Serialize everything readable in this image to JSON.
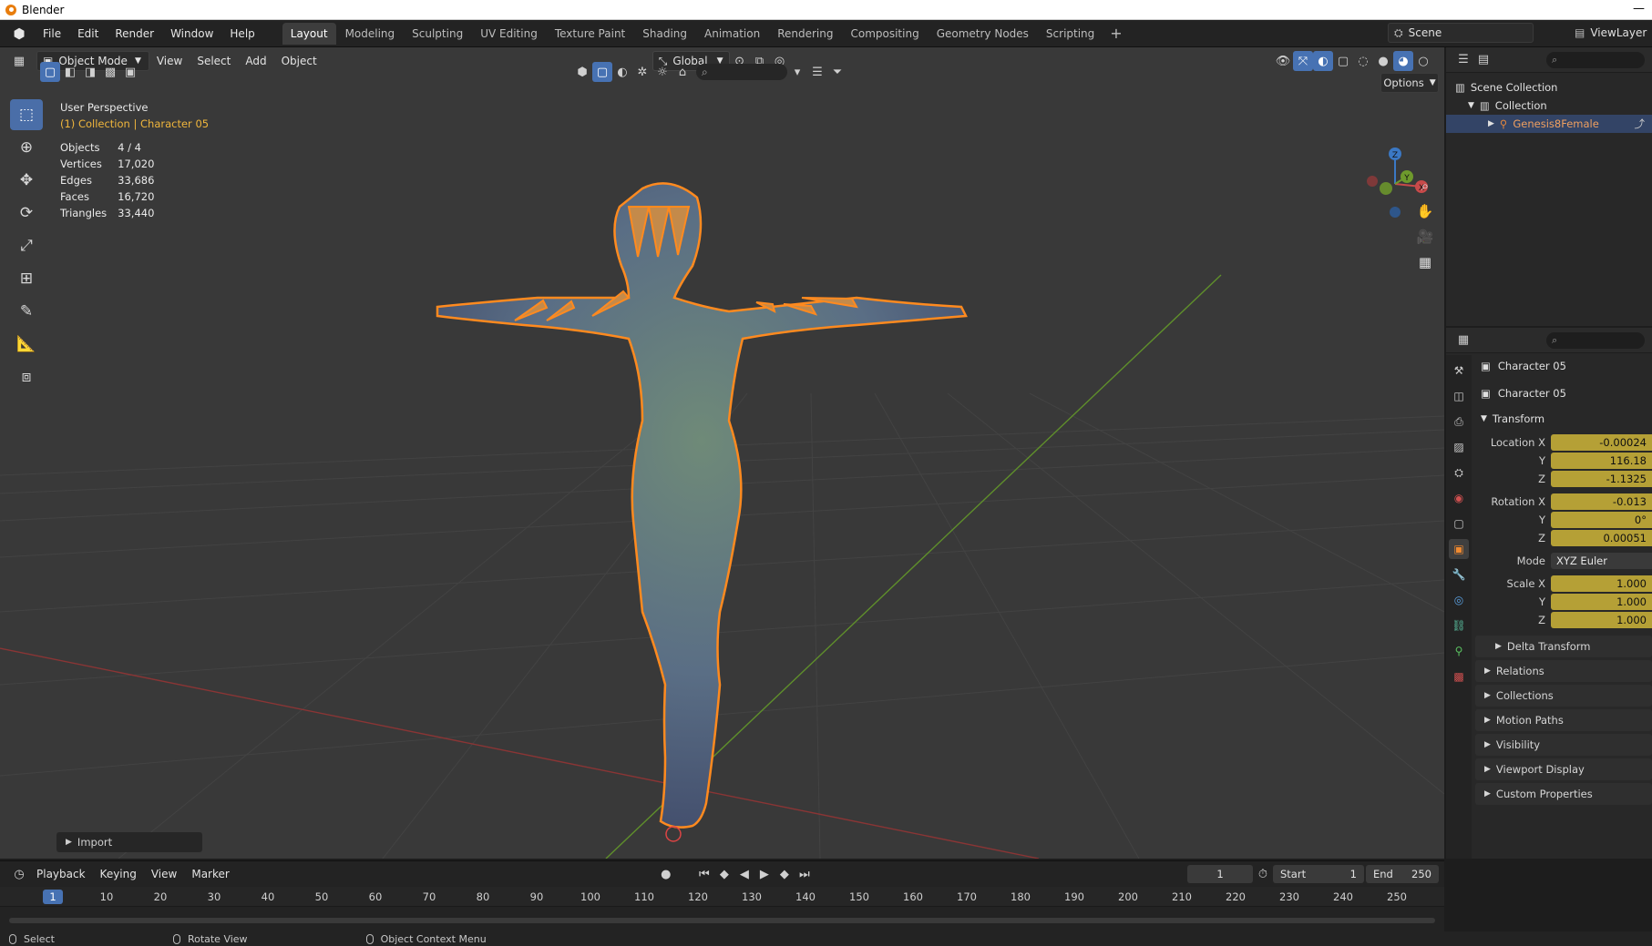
{
  "window": {
    "title": "Blender",
    "minimize_glyph": "—"
  },
  "menu": [
    "File",
    "Edit",
    "Render",
    "Window",
    "Help"
  ],
  "workspaces": [
    "Layout",
    "Modeling",
    "Sculpting",
    "UV Editing",
    "Texture Paint",
    "Shading",
    "Animation",
    "Rendering",
    "Compositing",
    "Geometry Nodes",
    "Scripting"
  ],
  "active_workspace": "Layout",
  "add_workspace": "+",
  "scene": "Scene",
  "view_layer": "ViewLayer",
  "viewport": {
    "mode": "Object Mode",
    "menus": [
      "View",
      "Select",
      "Add",
      "Object"
    ],
    "orientation": "Global",
    "options": "Options",
    "overlay_title": "User Perspective",
    "overlay_sub": "(1) Collection | Character 05",
    "stats": [
      {
        "label": "Objects",
        "value": "4 / 4"
      },
      {
        "label": "Vertices",
        "value": "17,020"
      },
      {
        "label": "Edges",
        "value": "33,686"
      },
      {
        "label": "Faces",
        "value": "16,720"
      },
      {
        "label": "Triangles",
        "value": "33,440"
      }
    ],
    "gizmo": {
      "z": "Z",
      "y": "Y",
      "x": "X"
    },
    "import_panel": "Import",
    "accent_colors": {
      "outline": "#ff8a1f",
      "x_axis": "#b33b3b",
      "y_axis": "#6e9a2c",
      "active_blue": "#4772b3"
    }
  },
  "outliner": {
    "root": "Scene Collection",
    "collection": "Collection",
    "object": "Genesis8Female"
  },
  "properties": {
    "object_name": "Character 05",
    "data_name": "Character 05",
    "transform_label": "Transform",
    "location": {
      "label": "Location X",
      "x": "-0.00024",
      "y": "116.18",
      "z": "-1.1325"
    },
    "rotation": {
      "label": "Rotation X",
      "x": "-0.013",
      "y": "0°",
      "z": "0.00051"
    },
    "mode": {
      "label": "Mode",
      "value": "XYZ Euler"
    },
    "scale": {
      "label": "Scale X",
      "x": "1.000",
      "y": "1.000",
      "z": "1.000"
    },
    "axis_y": "Y",
    "axis_z": "Z",
    "sections": [
      "Delta Transform",
      "Relations",
      "Collections",
      "Motion Paths",
      "Visibility",
      "Viewport Display",
      "Custom Properties"
    ]
  },
  "timeline": {
    "menus": [
      "Playback",
      "Keying",
      "View",
      "Marker"
    ],
    "current_frame": "1",
    "start_label": "Start",
    "start": "1",
    "end_label": "End",
    "end": "250",
    "ticks": [
      "1",
      "10",
      "20",
      "30",
      "40",
      "50",
      "60",
      "70",
      "80",
      "90",
      "100",
      "110",
      "120",
      "130",
      "140",
      "150",
      "160",
      "170",
      "180",
      "190",
      "200",
      "210",
      "220",
      "230",
      "240",
      "250"
    ]
  },
  "statusbar": [
    "Select",
    "Rotate View",
    "Object Context Menu"
  ]
}
